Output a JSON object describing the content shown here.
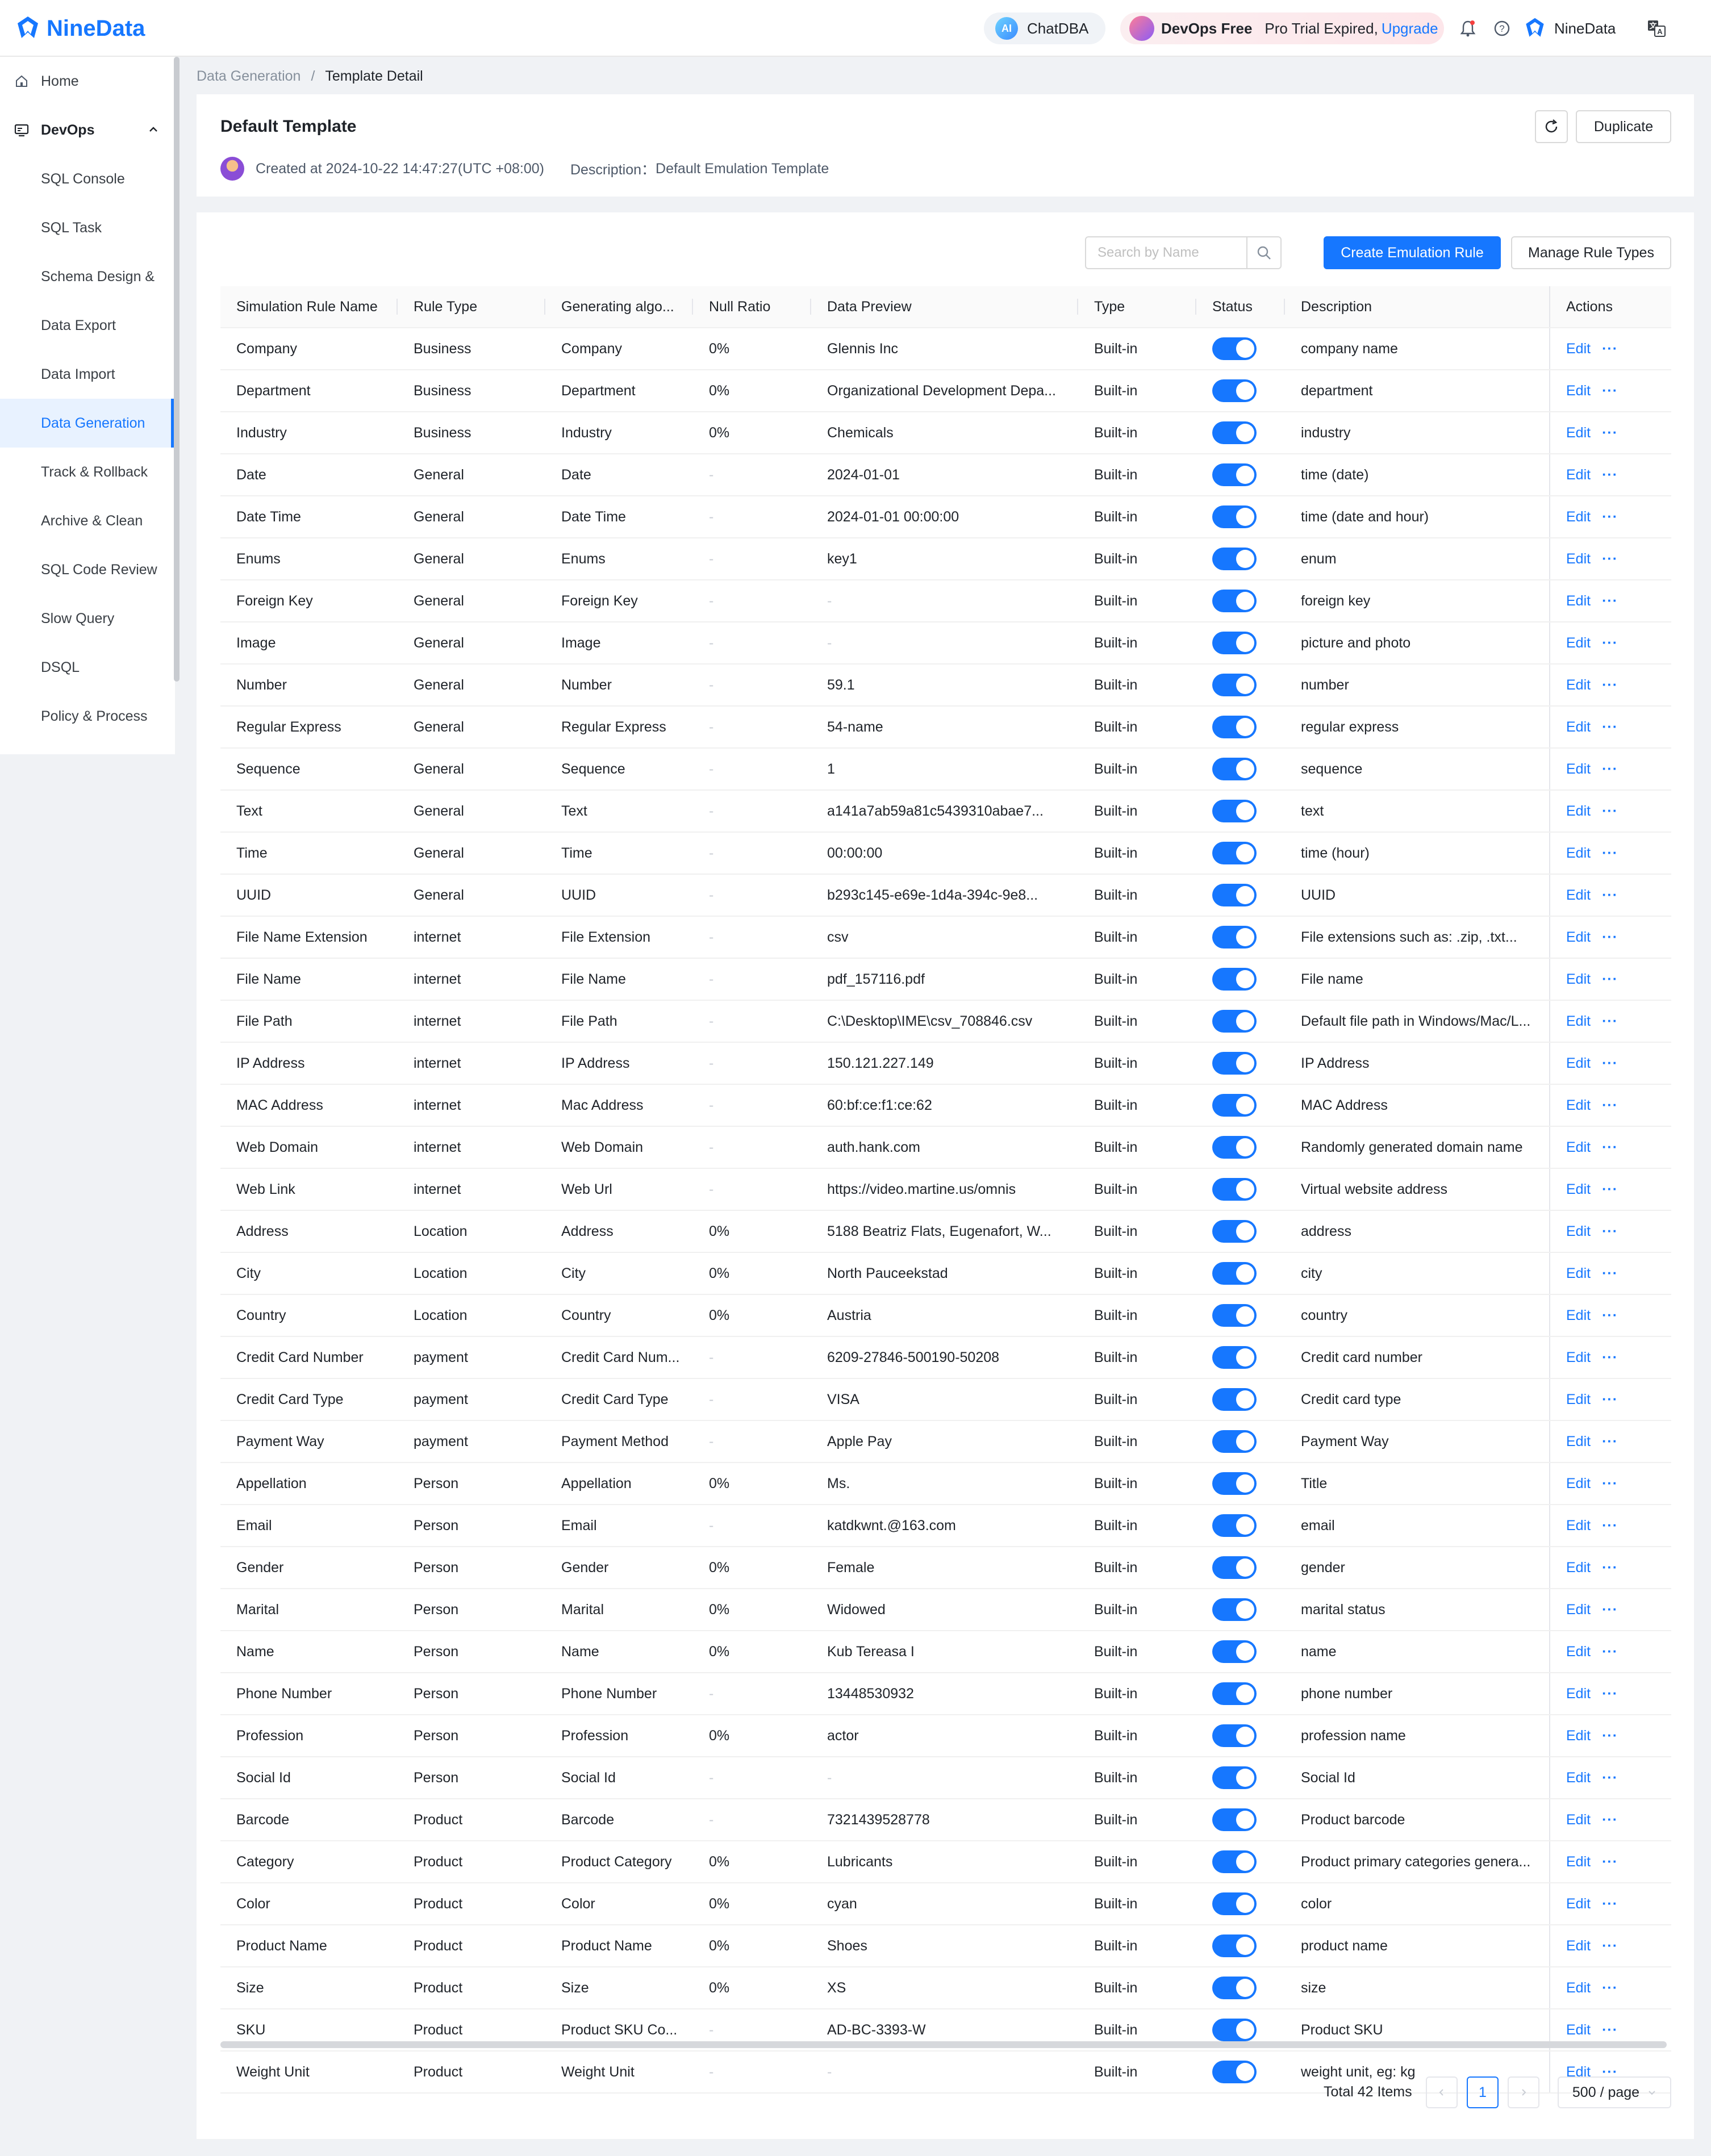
{
  "app": {
    "brand": "NineData"
  },
  "header": {
    "chatdba_label": "ChatDBA",
    "ai_badge": "AI",
    "devops_free": "DevOps Free",
    "trial_text": "Pro Trial Expired,",
    "upgrade_label": "Upgrade",
    "user_name": "NineData"
  },
  "sidebar": {
    "home": "Home",
    "devops": "DevOps",
    "items": [
      "SQL Console",
      "SQL Task",
      "Schema Design &",
      "Data Export",
      "Data Import",
      "Data Generation",
      "Track & Rollback",
      "Archive & Clean",
      "SQL Code Review",
      "Slow Query",
      "DSQL",
      "Policy & Process"
    ],
    "active_index": 5
  },
  "breadcrumb": {
    "parent": "Data Generation",
    "sep": "/",
    "current": "Template Detail"
  },
  "template": {
    "title": "Default Template",
    "created": "Created at 2024-10-22 14:47:27(UTC +08:00)",
    "description_label": "Description：",
    "description": "Default Emulation Template",
    "duplicate_label": "Duplicate"
  },
  "toolbar": {
    "search_placeholder": "Search by Name",
    "create_label": "Create Emulation Rule",
    "manage_label": "Manage Rule Types"
  },
  "table": {
    "columns": [
      "Simulation Rule Name",
      "Rule Type",
      "Generating algo...",
      "Null Ratio",
      "Data Preview",
      "Type",
      "Status",
      "Description",
      "Actions"
    ],
    "edit_label": "Edit",
    "more_label": "···",
    "rows": [
      [
        "Company",
        "Business",
        "Company",
        "0%",
        "Glennis Inc",
        "Built-in",
        "company name"
      ],
      [
        "Department",
        "Business",
        "Department",
        "0%",
        "Organizational Development Depa...",
        "Built-in",
        "department"
      ],
      [
        "Industry",
        "Business",
        "Industry",
        "0%",
        "Chemicals",
        "Built-in",
        "industry"
      ],
      [
        "Date",
        "General",
        "Date",
        "-",
        "2024-01-01",
        "Built-in",
        "time (date)"
      ],
      [
        "Date Time",
        "General",
        "Date Time",
        "-",
        "2024-01-01 00:00:00",
        "Built-in",
        "time (date and hour)"
      ],
      [
        "Enums",
        "General",
        "Enums",
        "-",
        "key1",
        "Built-in",
        "enum"
      ],
      [
        "Foreign Key",
        "General",
        "Foreign Key",
        "-",
        "-",
        "Built-in",
        "foreign key"
      ],
      [
        "Image",
        "General",
        "Image",
        "-",
        "-",
        "Built-in",
        "picture and photo"
      ],
      [
        "Number",
        "General",
        "Number",
        "-",
        "59.1",
        "Built-in",
        "number"
      ],
      [
        "Regular Express",
        "General",
        "Regular Express",
        "-",
        "54-name",
        "Built-in",
        "regular express"
      ],
      [
        "Sequence",
        "General",
        "Sequence",
        "-",
        "1",
        "Built-in",
        "sequence"
      ],
      [
        "Text",
        "General",
        "Text",
        "-",
        "a141a7ab59a81c5439310abae7...",
        "Built-in",
        "text"
      ],
      [
        "Time",
        "General",
        "Time",
        "-",
        "00:00:00",
        "Built-in",
        "time (hour)"
      ],
      [
        "UUID",
        "General",
        "UUID",
        "-",
        "b293c145-e69e-1d4a-394c-9e8...",
        "Built-in",
        "UUID"
      ],
      [
        "File Name Extension",
        "internet",
        "File Extension",
        "-",
        "csv",
        "Built-in",
        "File extensions such as: .zip, .txt..."
      ],
      [
        "File Name",
        "internet",
        "File Name",
        "-",
        "pdf_157116.pdf",
        "Built-in",
        "File name"
      ],
      [
        "File Path",
        "internet",
        "File Path",
        "-",
        "C:\\Desktop\\IME\\csv_708846.csv",
        "Built-in",
        "Default file path in Windows/Mac/L..."
      ],
      [
        "IP Address",
        "internet",
        "IP Address",
        "-",
        "150.121.227.149",
        "Built-in",
        "IP Address"
      ],
      [
        "MAC Address",
        "internet",
        "Mac Address",
        "-",
        "60:bf:ce:f1:ce:62",
        "Built-in",
        "MAC Address"
      ],
      [
        "Web Domain",
        "internet",
        "Web Domain",
        "-",
        "auth.hank.com",
        "Built-in",
        "Randomly generated domain name"
      ],
      [
        "Web Link",
        "internet",
        "Web Url",
        "-",
        "https://video.martine.us/omnis",
        "Built-in",
        "Virtual website address"
      ],
      [
        "Address",
        "Location",
        "Address",
        "0%",
        "5188 Beatriz Flats, Eugenafort, W...",
        "Built-in",
        "address"
      ],
      [
        "City",
        "Location",
        "City",
        "0%",
        "North Pauceekstad",
        "Built-in",
        "city"
      ],
      [
        "Country",
        "Location",
        "Country",
        "0%",
        "Austria",
        "Built-in",
        "country"
      ],
      [
        "Credit Card Number",
        "payment",
        "Credit Card Num...",
        "-",
        "6209-27846-500190-50208",
        "Built-in",
        "Credit card number"
      ],
      [
        "Credit Card Type",
        "payment",
        "Credit Card Type",
        "-",
        "VISA",
        "Built-in",
        "Credit card type"
      ],
      [
        "Payment Way",
        "payment",
        "Payment Method",
        "-",
        "Apple Pay",
        "Built-in",
        "Payment Way"
      ],
      [
        "Appellation",
        "Person",
        "Appellation",
        "0%",
        "Ms.",
        "Built-in",
        "Title"
      ],
      [
        "Email",
        "Person",
        "Email",
        "-",
        "katdkwnt.@163.com",
        "Built-in",
        "email"
      ],
      [
        "Gender",
        "Person",
        "Gender",
        "0%",
        "Female",
        "Built-in",
        "gender"
      ],
      [
        "Marital",
        "Person",
        "Marital",
        "0%",
        "Widowed",
        "Built-in",
        "marital status"
      ],
      [
        "Name",
        "Person",
        "Name",
        "0%",
        "Kub Tereasa I",
        "Built-in",
        "name"
      ],
      [
        "Phone Number",
        "Person",
        "Phone Number",
        "-",
        "13448530932",
        "Built-in",
        "phone number"
      ],
      [
        "Profession",
        "Person",
        "Profession",
        "0%",
        "actor",
        "Built-in",
        "profession name"
      ],
      [
        "Social Id",
        "Person",
        "Social Id",
        "-",
        "-",
        "Built-in",
        "Social Id"
      ],
      [
        "Barcode",
        "Product",
        "Barcode",
        "-",
        "7321439528778",
        "Built-in",
        "Product barcode"
      ],
      [
        "Category",
        "Product",
        "Product Category",
        "0%",
        "Lubricants",
        "Built-in",
        "Product primary categories genera..."
      ],
      [
        "Color",
        "Product",
        "Color",
        "0%",
        "cyan",
        "Built-in",
        "color"
      ],
      [
        "Product Name",
        "Product",
        "Product Name",
        "0%",
        "Shoes",
        "Built-in",
        "product name"
      ],
      [
        "Size",
        "Product",
        "Size",
        "0%",
        "XS",
        "Built-in",
        "size"
      ],
      [
        "SKU",
        "Product",
        "Product SKU Co...",
        "-",
        "AD-BC-3393-W",
        "Built-in",
        "Product SKU"
      ],
      [
        "Weight Unit",
        "Product",
        "Weight Unit",
        "-",
        "-",
        "Built-in",
        "weight unit, eg: kg"
      ]
    ]
  },
  "pagination": {
    "total": "Total 42 Items",
    "current": "1",
    "prev": "<",
    "next": ">",
    "page_size": "500 / page"
  },
  "colors": {
    "accent": "#1677ff"
  },
  "icons": [
    "logo-icon",
    "ai-icon",
    "rocket-icon",
    "bell-icon",
    "help-icon",
    "user-logo-icon",
    "translate-icon",
    "home-icon",
    "devops-icon",
    "chevron-up-icon",
    "refresh-icon",
    "search-icon",
    "chevron-down-icon"
  ]
}
